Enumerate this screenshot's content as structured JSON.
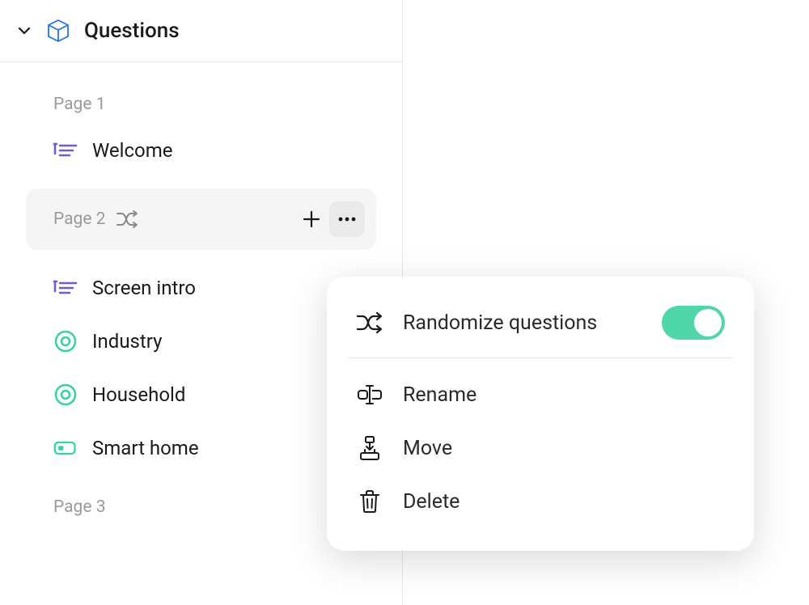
{
  "header": {
    "title": "Questions"
  },
  "pages": {
    "page1_label": "Page 1",
    "page2_label": "Page 2",
    "page3_label": "Page 3"
  },
  "items": {
    "welcome": "Welcome",
    "screen_intro": "Screen intro",
    "industry": "Industry",
    "household": "Household",
    "smart_home": "Smart home"
  },
  "popup": {
    "randomize": "Randomize questions",
    "rename": "Rename",
    "move": "Move",
    "delete": "Delete",
    "toggle_on": true
  },
  "colors": {
    "accent_purple": "#6b5dd3",
    "accent_teal": "#34d399",
    "icon_blue": "#2374e1"
  }
}
